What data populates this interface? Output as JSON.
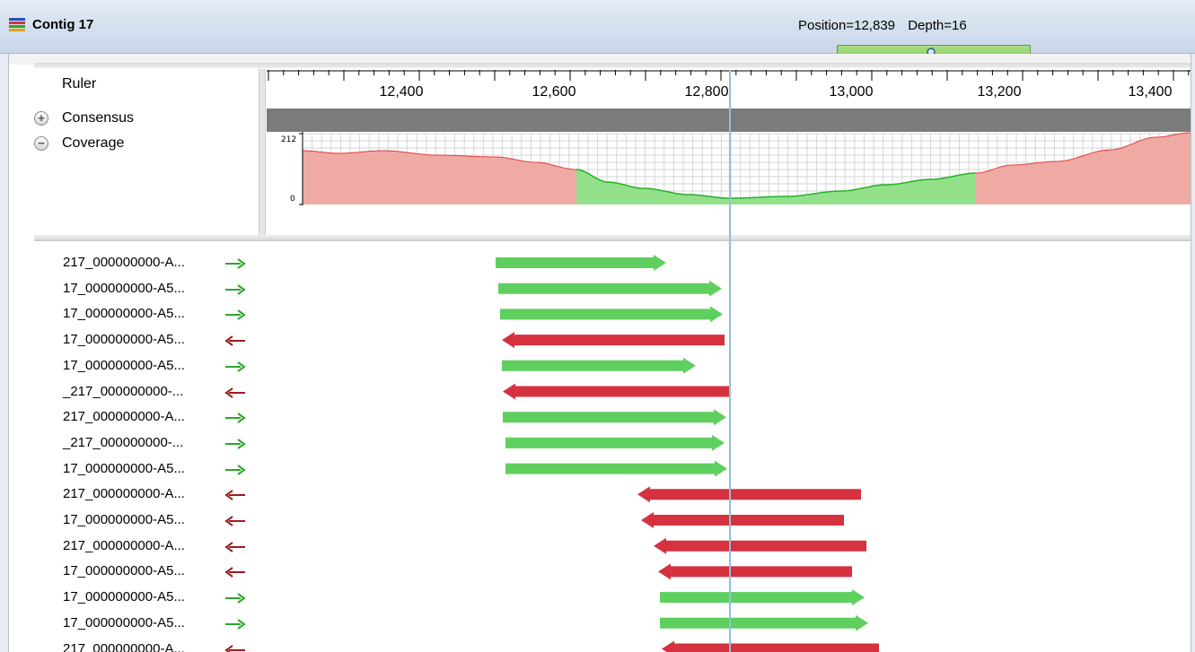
{
  "window": {
    "title": "Contig 17",
    "position_text": "Position=12,839",
    "depth_text": "Depth=16"
  },
  "tracks": {
    "ruler_label": "Ruler",
    "consensus_label": "Consensus",
    "coverage_label": "Coverage"
  },
  "ruler": {
    "labels": [
      "12,400",
      "12,600",
      "12,800",
      "13,000",
      "13,200",
      "13,400"
    ]
  },
  "coverage": {
    "y_max_label": "212",
    "y_min_label": "0",
    "colors": {
      "high": "#f0aaa4",
      "high_line": "#e33b3b",
      "low": "#93e08a",
      "low_line": "#27b027"
    }
  },
  "reads": [
    {
      "name": "217_000000000-A...",
      "direction": "forward"
    },
    {
      "name": "17_000000000-A5...",
      "direction": "forward"
    },
    {
      "name": "17_000000000-A5...",
      "direction": "forward"
    },
    {
      "name": "17_000000000-A5...",
      "direction": "reverse"
    },
    {
      "name": "17_000000000-A5...",
      "direction": "forward"
    },
    {
      "name": "_217_000000000-...",
      "direction": "reverse"
    },
    {
      "name": "217_000000000-A...",
      "direction": "forward"
    },
    {
      "name": "_217_000000000-...",
      "direction": "forward"
    },
    {
      "name": "17_000000000-A5...",
      "direction": "forward"
    },
    {
      "name": "217_000000000-A...",
      "direction": "reverse"
    },
    {
      "name": "17_000000000-A5...",
      "direction": "reverse"
    },
    {
      "name": "217_000000000-A...",
      "direction": "reverse"
    },
    {
      "name": "17_000000000-A5...",
      "direction": "reverse"
    },
    {
      "name": "17_000000000-A5...",
      "direction": "forward"
    },
    {
      "name": "17_000000000-A5...",
      "direction": "forward"
    },
    {
      "name": "217_000000000-A...",
      "direction": "reverse"
    }
  ],
  "colors": {
    "forward": "#5fcf5f",
    "forward_arrow": "#2fa52f",
    "reverse": "#d5313f",
    "reverse_arrow": "#9b1c1c"
  }
}
